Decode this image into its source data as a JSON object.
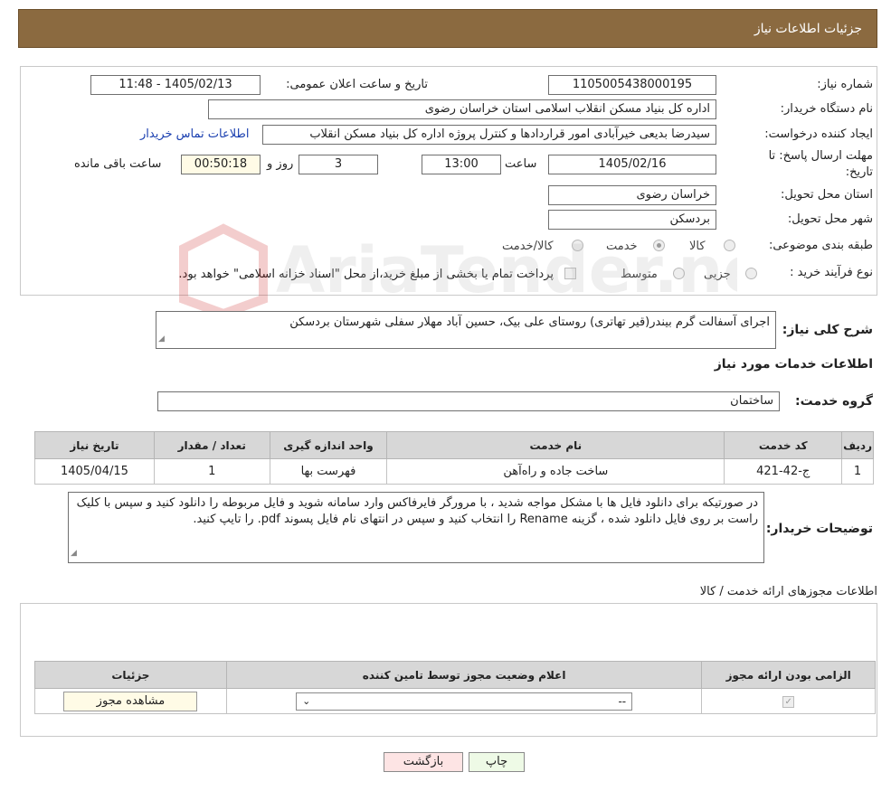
{
  "header": {
    "title": "جزئیات اطلاعات نیاز"
  },
  "need": {
    "number_label": "شماره نیاز:",
    "number_value": "1105005438000195",
    "announce_label": "تاریخ و ساعت اعلان عمومی:",
    "announce_value": "1405/02/13 - 11:48",
    "buyer_label": "نام دستگاه خریدار:",
    "buyer_value": "اداره کل بنیاد مسکن انقلاب اسلامی استان خراسان رضوی",
    "creator_label": "ایجاد کننده درخواست:",
    "creator_value": "سیدرضا بدیعی خیرآبادی امور قراردادها و کنترل پروژه اداره کل بنیاد مسکن انقلاب",
    "contact_link": "اطلاعات تماس خریدار",
    "deadline_label_1": "مهلت ارسال پاسخ: تا",
    "deadline_label_2": "تاریخ:",
    "deadline_date": "1405/02/16",
    "time_label": "ساعت",
    "deadline_time": "13:00",
    "days_value": "3",
    "days_label": "روز و",
    "remaining_value": "00:50:18",
    "remaining_label": "ساعت باقی مانده",
    "province_label": "استان محل تحویل:",
    "province_value": "خراسان رضوی",
    "city_label": "شهر محل تحویل:",
    "city_value": "بردسکن",
    "category_label": "طبقه بندی موضوعی:",
    "category_options": [
      "کالا",
      "خدمت",
      "کالا/خدمت"
    ],
    "category_selected": 1,
    "process_label": "نوع فرآیند خرید :",
    "process_options": [
      "جزیی",
      "متوسط"
    ],
    "process_note": "پرداخت تمام یا بخشی از مبلغ خرید،از محل \"اسناد خزانه اسلامی\" خواهد بود."
  },
  "summary": {
    "label": "شرح کلی نیاز:",
    "value": "اجرای آسفالت گرم بیندر(قیر تهاتری) روستای علی بیک، حسین آباد مهلار سفلی شهرستان بردسکن"
  },
  "services": {
    "section_title": "اطلاعات خدمات مورد نیاز",
    "group_label": "گروه خدمت:",
    "group_value": "ساختمان",
    "columns": [
      "ردیف",
      "کد خدمت",
      "نام خدمت",
      "واحد اندازه گیری",
      "تعداد / مقدار",
      "تاریخ نیاز"
    ],
    "rows": [
      [
        "1",
        "ج-42-421",
        "ساخت جاده و راه‌آهن",
        "فهرست بها",
        "1",
        "1405/04/15"
      ]
    ]
  },
  "buyer_notes": {
    "label": "توضیحات خریدار:",
    "value": "در صورتیکه برای دانلود فایل ها با مشکل مواجه شدید ، با مرورگر فایرفاکس وارد سامانه شوید و فایل مربوطه را دانلود کنید و سپس با کلیک راست بر روی فایل دانلود شده ، گزینه Rename را انتخاب کنید و سپس در انتهای نام فایل پسوند pdf. را تایپ کنید."
  },
  "permits": {
    "section_title": "اطلاعات مجوزهای ارائه خدمت / کالا",
    "columns": [
      "الزامی بودن ارائه مجوز",
      "اعلام وضعیت مجوز توسط تامین کننده",
      "جزئیات"
    ],
    "select_value": "--",
    "view_button": "مشاهده مجوز"
  },
  "footer": {
    "print_button": "چاپ",
    "back_button": "بازگشت"
  },
  "watermark": {
    "text": "AriaTender.neT"
  },
  "colors": {
    "header_bg": "#8b6a40",
    "back_button_bg": "#fde4e4",
    "print_button_bg": "#eefae6",
    "link": "#1a3fb0"
  }
}
